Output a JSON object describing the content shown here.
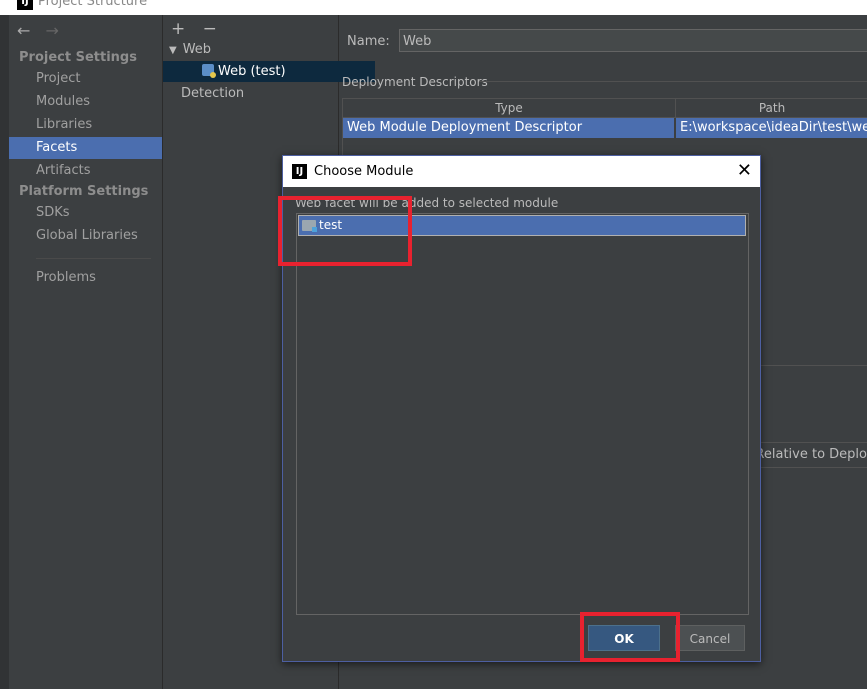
{
  "window": {
    "title": "Project Structure",
    "app_icon": "intellij-icon"
  },
  "nav": {
    "back": "←",
    "forward": "→"
  },
  "sidebar": {
    "project_settings_header": "Project Settings",
    "project_settings_items": [
      {
        "label": "Project"
      },
      {
        "label": "Modules"
      },
      {
        "label": "Libraries"
      },
      {
        "label": "Facets",
        "selected": true
      },
      {
        "label": "Artifacts"
      }
    ],
    "platform_settings_header": "Platform Settings",
    "platform_settings_items": [
      {
        "label": "SDKs"
      },
      {
        "label": "Global Libraries"
      }
    ],
    "problems": "Problems"
  },
  "facet_tree": {
    "toolbar": {
      "add": "+",
      "remove": "−"
    },
    "root": "Web",
    "child": "Web (test)",
    "detection": "Detection"
  },
  "main": {
    "name_label": "Name:",
    "name_value": "Web",
    "deployment_descriptors_label": "Deployment Descriptors",
    "table": {
      "columns": [
        "Type",
        "Path"
      ],
      "rows": [
        {
          "type": "Web Module Deployment Descriptor",
          "path": "E:\\workspace\\ideaDir\\test\\web\\"
        }
      ]
    },
    "relative_header": "Path Relative to Deplo"
  },
  "dialog": {
    "title": "Choose Module",
    "message": "Web facet will be added to selected module",
    "modules": [
      {
        "name": "test",
        "selected": true
      }
    ],
    "ok_label": "OK",
    "cancel_label": "Cancel",
    "close": "✕"
  },
  "colors": {
    "selection": "#4b6eaf",
    "highlight_annotation": "#e8222f",
    "background": "#3c3f41"
  }
}
